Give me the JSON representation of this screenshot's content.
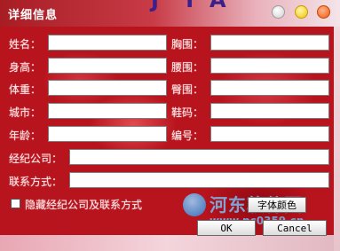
{
  "window": {
    "title": "详细信息",
    "controls": [
      "restore-icon",
      "minimize-icon",
      "close-icon"
    ],
    "accent_color": "#b8141e"
  },
  "form": {
    "left_fields": [
      {
        "label": "姓名：",
        "value": ""
      },
      {
        "label": "身高：",
        "value": ""
      },
      {
        "label": "体重：",
        "value": ""
      },
      {
        "label": "城市：",
        "value": ""
      },
      {
        "label": "年龄：",
        "value": ""
      }
    ],
    "right_fields": [
      {
        "label": "胸围：",
        "value": ""
      },
      {
        "label": "腰围：",
        "value": ""
      },
      {
        "label": "臀围：",
        "value": ""
      },
      {
        "label": "鞋码：",
        "value": ""
      },
      {
        "label": "编号：",
        "value": ""
      }
    ],
    "agency": {
      "label": "经纪公司：",
      "value": ""
    },
    "contact": {
      "label": "联系方式：",
      "value": ""
    },
    "hide_checkbox": {
      "label": "隐藏经纪公司及联系方式",
      "checked": false
    }
  },
  "buttons": {
    "font_color": "字体颜色",
    "ok": "OK",
    "cancel": "Cancel"
  },
  "watermark": {
    "text": "河东软件园",
    "url": "www.pc0359.cn"
  }
}
